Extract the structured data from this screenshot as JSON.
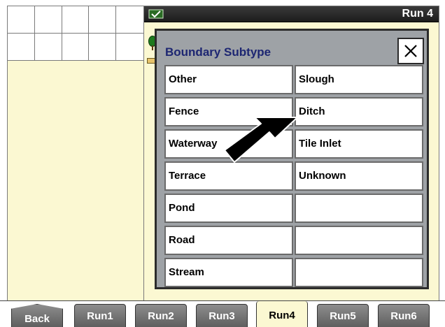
{
  "header": {
    "run_title": "Run 4"
  },
  "dialog": {
    "title": "Boundary Subtype",
    "close_icon": "close-icon",
    "options": [
      "Other",
      "Slough",
      "Fence",
      "Ditch",
      "Waterway",
      "Tile Inlet",
      "Terrace",
      "Unknown",
      "Pond",
      "",
      "Road",
      "",
      "Stream",
      ""
    ]
  },
  "tabs": {
    "back": "Back",
    "items": [
      "Run1",
      "Run2",
      "Run3",
      "Run4",
      "Run5",
      "Run6"
    ],
    "active": "Run4"
  },
  "icons": {
    "title_icon": "checkmark-icon",
    "pointer": "arrow-pointer-icon",
    "map_marker": "tree-marker-icon"
  },
  "colors": {
    "panel_bg": "#fbf8d2",
    "dialog_bg": "#9ea2a6",
    "title_text": "#1d2672",
    "header_bar": "#2a2a2a",
    "tab_bg": "#6e6e6e"
  }
}
